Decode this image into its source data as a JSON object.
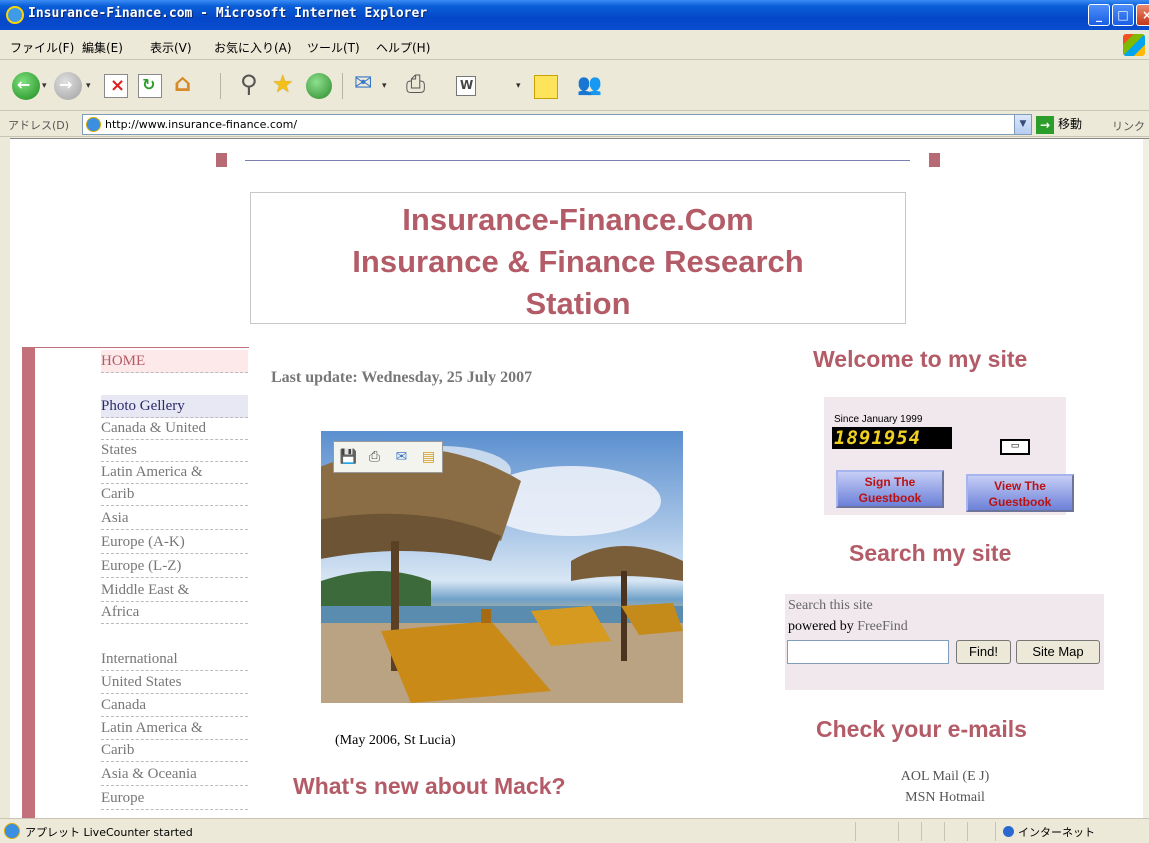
{
  "window": {
    "title": "Insurance-Finance.com - Microsoft Internet Explorer"
  },
  "menu": {
    "file": "ファイル(F)",
    "edit": "編集(E)",
    "view": "表示(V)",
    "favorites": "お気に入り(A)",
    "tools": "ツール(T)",
    "help": "ヘルプ(H)"
  },
  "address": {
    "label": "アドレス(D)",
    "url": "http://www.insurance-finance.com/",
    "go": "移動",
    "links": "リンク"
  },
  "page": {
    "title_line1": "Insurance-Finance.Com",
    "title_line2": "Insurance & Finance Research",
    "title_line3": "Station",
    "last_update": "Last update: Wednesday, 25 July 2007",
    "caption": "(May 2006, St Lucia)",
    "whats_new": "What's new about Mack?"
  },
  "sidebar": {
    "home": "HOME",
    "items1": [
      "Photo Gellery",
      "Canada & United",
      "States",
      "Latin America &",
      "Carib",
      "Asia",
      "Europe (A-K)",
      "Europe (L-Z)",
      "Middle East &",
      "Africa"
    ],
    "items2": [
      "International",
      "United States",
      "Canada",
      "Latin America &",
      "Carib",
      "Asia & Oceania",
      "Europe"
    ]
  },
  "right": {
    "welcome": "Welcome to my site",
    "since": "Since January 1999",
    "counter": "1891954",
    "sign": "Sign The Guestbook",
    "view": "View The Guestbook",
    "search_title": "Search my site",
    "search_this": "Search this site",
    "powered": "powered by",
    "freefind": "FreeFind",
    "find_btn": "Find!",
    "sitemap_btn": "Site Map",
    "emails_title": "Check your e-mails",
    "email1": "AOL Mail (E J)",
    "email2": "MSN Hotmail"
  },
  "status": {
    "text": "アプレット LiveCounter started",
    "zone": "インターネット"
  },
  "colors": {
    "accent": "#b35c68",
    "sidebar_bar": "#c4707a"
  }
}
